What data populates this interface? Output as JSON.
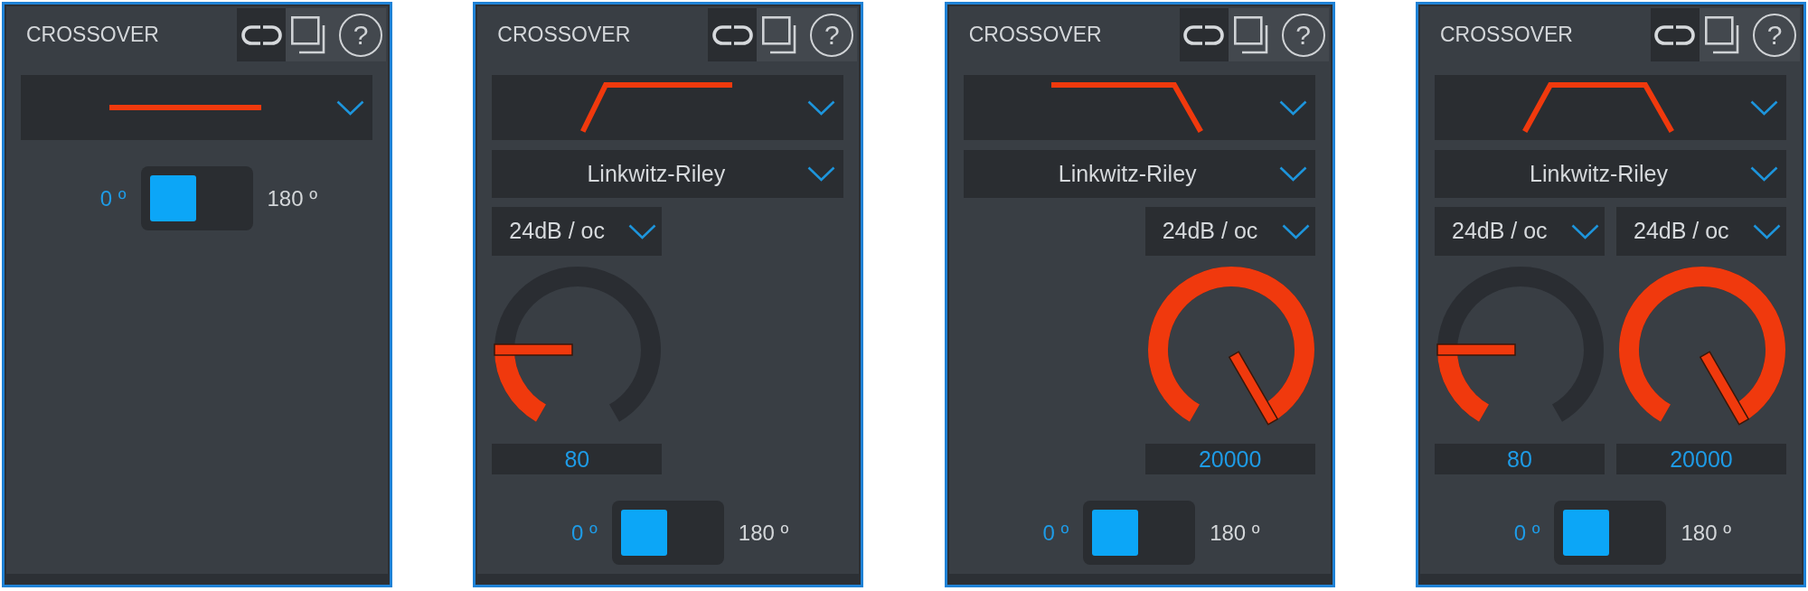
{
  "panels": [
    {
      "title": "CROSSOVER",
      "help_button": "?",
      "shape_dropdown": {
        "kind": "flat"
      },
      "phase": {
        "left_label": "0 º",
        "right_label": "180 º",
        "on": false
      }
    },
    {
      "title": "CROSSOVER",
      "help_button": "?",
      "shape_dropdown": {
        "kind": "high_pass"
      },
      "type_dropdown": "Linkwitz-Riley",
      "left_column": {
        "slope": "24dB / oc",
        "knob": {
          "level": 0.2
        },
        "value": "80"
      },
      "phase": {
        "left_label": "0 º",
        "right_label": "180 º",
        "on": false
      }
    },
    {
      "title": "CROSSOVER",
      "help_button": "?",
      "shape_dropdown": {
        "kind": "low_pass"
      },
      "type_dropdown": "Linkwitz-Riley",
      "right_column": {
        "slope": "24dB / oc",
        "knob": {
          "level": 1
        },
        "value": "20000"
      },
      "phase": {
        "left_label": "0 º",
        "right_label": "180 º",
        "on": false
      }
    },
    {
      "title": "CROSSOVER",
      "help_button": "?",
      "shape_dropdown": {
        "kind": "band_pass"
      },
      "type_dropdown": "Linkwitz-Riley",
      "left_column": {
        "slope": "24dB / oc",
        "knob": {
          "level": 0.2
        },
        "value": "80"
      },
      "right_column": {
        "slope": "24dB / oc",
        "knob": {
          "level": 1
        },
        "value": "20000"
      },
      "phase": {
        "left_label": "0 º",
        "right_label": "180 º",
        "on": false
      }
    }
  ]
}
